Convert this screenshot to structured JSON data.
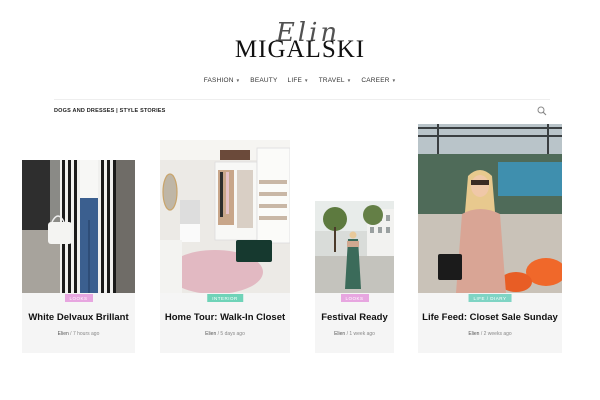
{
  "site": {
    "logo_script": "Elin",
    "logo_main": "MIGALSKI"
  },
  "nav": {
    "items": [
      {
        "label": "FASHION",
        "has_submenu": true
      },
      {
        "label": "BEAUTY",
        "has_submenu": false
      },
      {
        "label": "LIFE",
        "has_submenu": true
      },
      {
        "label": "TRAVEL",
        "has_submenu": true
      },
      {
        "label": "CAREER",
        "has_submenu": true
      }
    ]
  },
  "category": {
    "breadcrumb": "DOGS AND DRESSES | STYLE STORIES"
  },
  "colors": {
    "tag_looks": "#e7a6e0",
    "tag_interior": "#6fd3b8",
    "tag_lifediary": "#7fd4c4",
    "card_bg": "#f5f5f5"
  },
  "posts": [
    {
      "tag": "LOOKS",
      "title": "White Delvaux Brillant",
      "author": "Elien",
      "sep": "/",
      "time": "7 hours ago"
    },
    {
      "tag": "INTERIOR",
      "title": "Home Tour: Walk-In Closet",
      "author": "Elien",
      "sep": "/",
      "time": "5 days ago"
    },
    {
      "tag": "LOOKS",
      "title": "Festival Ready",
      "author": "Elien",
      "sep": "/",
      "time": "1 week ago"
    },
    {
      "tag": "LIFE / DIARY",
      "title": "Life Feed: Closet Sale Sunday",
      "author": "Elien",
      "sep": "/",
      "time": "2 weeks ago"
    }
  ]
}
